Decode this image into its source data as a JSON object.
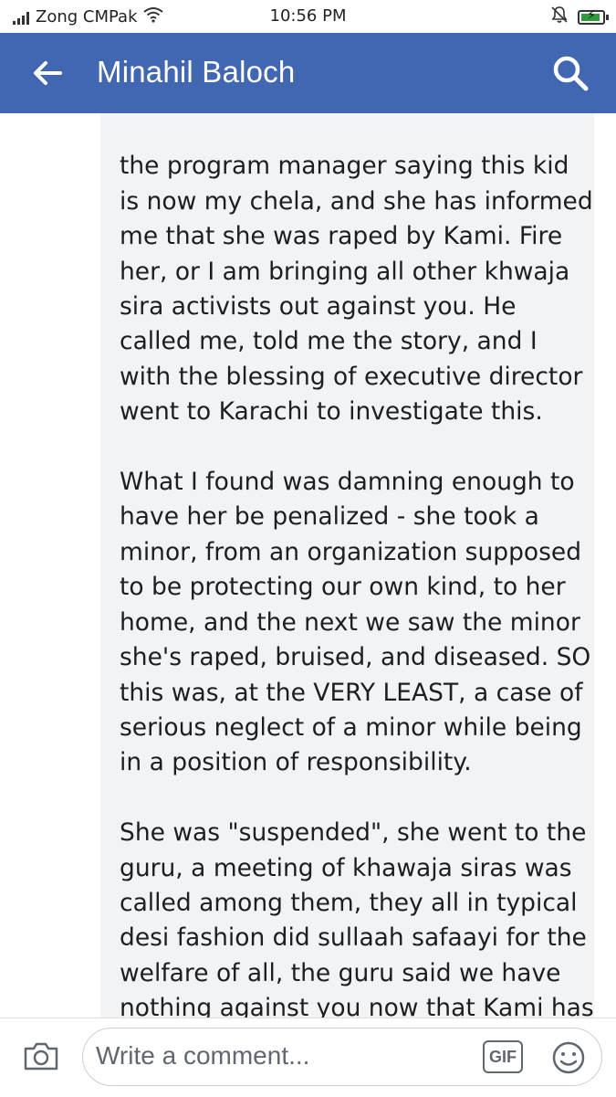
{
  "status_bar": {
    "carrier": "Zong CMPak",
    "time": "10:56 PM"
  },
  "header": {
    "title": "Minahil Baloch",
    "back_icon": "arrow-left-icon",
    "search_icon": "search-icon",
    "background_color": "#4267b2"
  },
  "comment": {
    "paragraphs": [
      "the program manager saying this kid is now my chela, and she has informed me that she was raped by Kami. Fire her, or I am bringing all other khwaja sira activists out against you. He called me, told me the story, and I with the blessing of executive director went to Karachi to investigate this.",
      "What I found was damning enough to have her be penalized - she took a minor, from an organization supposed to be protecting our own kind, to her home, and the next we saw the minor she's raped, bruised, and diseased. SO this was, at the VERY LEAST, a case of serious neglect of a minor while being in a position of responsibility.",
      "She was \"suspended\", she went to the guru, a meeting of khawaja siras was called among them, they all in typical desi fashion did sullaah safaayi for the welfare of all, the guru said we have nothing against you now that Kami has apologized, and Kami was"
    ]
  },
  "composer": {
    "placeholder": "Write a comment...",
    "gif_label": "GIF",
    "camera_icon": "camera-icon",
    "emoji_icon": "emoji-icon"
  }
}
